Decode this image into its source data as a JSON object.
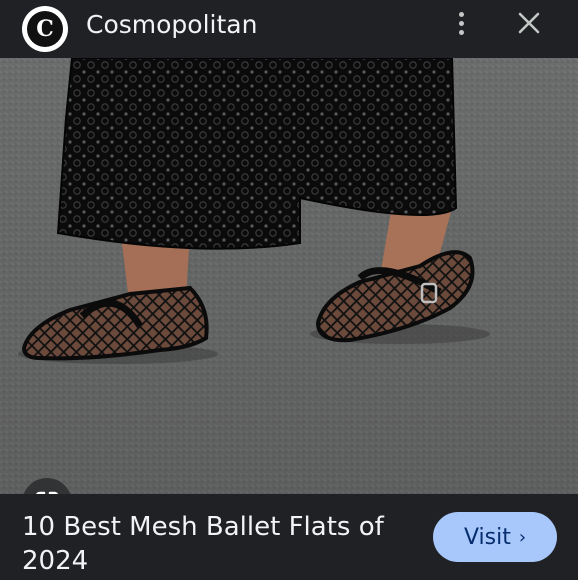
{
  "header": {
    "logo_letter": "C",
    "site_name": "Cosmopolitan",
    "more_icon": "more-vert-icon",
    "close_icon": "close-icon"
  },
  "image": {
    "lens_icon": "google-lens-icon"
  },
  "caption": {
    "title": "10 Best Mesh Ballet Flats of 2024",
    "visit_label": "Visit",
    "visit_chevron": "›"
  },
  "colors": {
    "background": "#1f2124",
    "visit_button": "#a8c7fa",
    "visit_text": "#062e6f"
  }
}
